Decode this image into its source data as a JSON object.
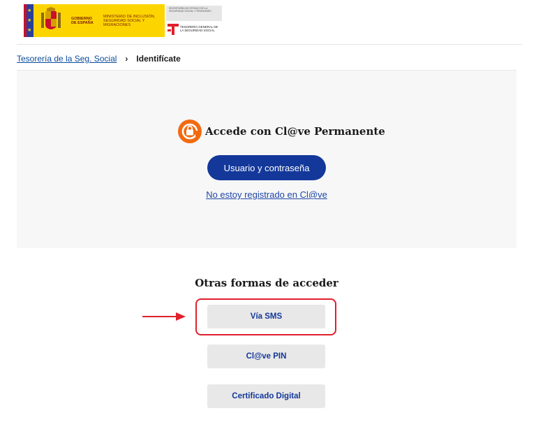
{
  "header": {
    "gov_label": "GOBIERNO DE ESPAÑA",
    "ministry_label": "MINISTERIO DE INCLUSIÓN, SEGURIDAD SOCIAL Y MIGRACIONES",
    "secretary_label": "SECRETARÍA DE ESTADO DE LA SEGURIDAD SOCIAL Y PENSIONES",
    "tgss_label": "TESORERÍA GENERAL DE LA SEGURIDAD SOCIAL"
  },
  "breadcrumb": {
    "parent": "Tesorería de la Seg. Social",
    "separator": "›",
    "current": "Identifícate"
  },
  "clave_panel": {
    "title": "Accede con Cl@ve Permanente",
    "primary_button": "Usuario y contraseña",
    "register_link": "No estoy registrado en Cl@ve"
  },
  "other_methods": {
    "title": "Otras formas de acceder",
    "buttons": [
      "Vía SMS",
      "Cl@ve PIN",
      "Certificado Digital"
    ]
  },
  "colors": {
    "primary": "#13389a",
    "link": "#1f47a8",
    "clave_orange": "#f26a10",
    "highlight_red": "#e0202d",
    "gov_yellow": "#fcd500"
  }
}
